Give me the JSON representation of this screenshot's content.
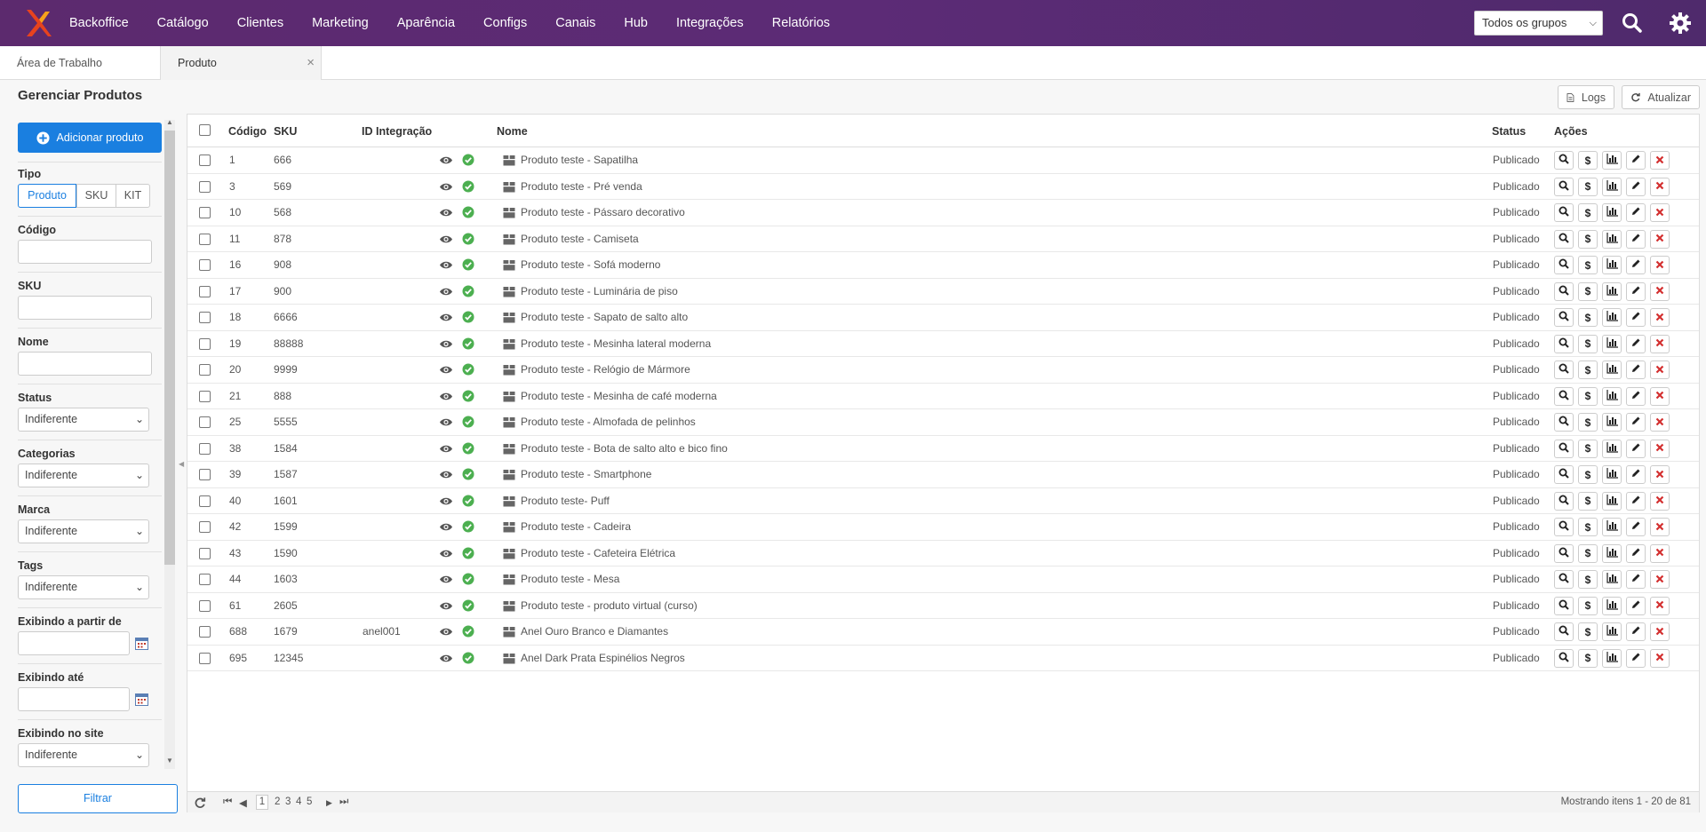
{
  "nav": {
    "items": [
      "Backoffice",
      "Catálogo",
      "Clientes",
      "Marketing",
      "Aparência",
      "Configs",
      "Canais",
      "Hub",
      "Integrações",
      "Relatórios"
    ],
    "group_select": "Todos os grupos"
  },
  "tabs": {
    "workspace": "Área de Trabalho",
    "product": "Produto"
  },
  "page": {
    "title": "Gerenciar Produtos",
    "logs": "Logs",
    "refresh": "Atualizar"
  },
  "sidebar": {
    "add_button": "Adicionar produto",
    "tipo_label": "Tipo",
    "tipo_options": [
      "Produto",
      "SKU",
      "KIT"
    ],
    "codigo_label": "Código",
    "sku_label": "SKU",
    "nome_label": "Nome",
    "status_label": "Status",
    "status_value": "Indiferente",
    "categorias_label": "Categorias",
    "categorias_value": "Indiferente",
    "marca_label": "Marca",
    "marca_value": "Indiferente",
    "tags_label": "Tags",
    "tags_value": "Indiferente",
    "from_label": "Exibindo a partir de",
    "until_label": "Exibindo até",
    "site_label": "Exibindo no site",
    "site_value": "Indiferente",
    "filter_button": "Filtrar"
  },
  "table": {
    "headers": {
      "codigo": "Código",
      "sku": "SKU",
      "id_integracao": "ID Integração",
      "nome": "Nome",
      "status": "Status",
      "acoes": "Ações"
    },
    "rows": [
      {
        "codigo": "1",
        "sku": "666",
        "id": "",
        "nome": "Produto teste - Sapatilha",
        "status": "Publicado"
      },
      {
        "codigo": "3",
        "sku": "569",
        "id": "",
        "nome": "Produto teste - Pré venda",
        "status": "Publicado"
      },
      {
        "codigo": "10",
        "sku": "568",
        "id": "",
        "nome": "Produto teste - Pássaro decorativo",
        "status": "Publicado"
      },
      {
        "codigo": "11",
        "sku": "878",
        "id": "",
        "nome": "Produto teste - Camiseta",
        "status": "Publicado"
      },
      {
        "codigo": "16",
        "sku": "908",
        "id": "",
        "nome": "Produto teste - Sofá moderno",
        "status": "Publicado"
      },
      {
        "codigo": "17",
        "sku": "900",
        "id": "",
        "nome": "Produto teste - Luminária de piso",
        "status": "Publicado"
      },
      {
        "codigo": "18",
        "sku": "6666",
        "id": "",
        "nome": "Produto teste - Sapato de salto alto",
        "status": "Publicado"
      },
      {
        "codigo": "19",
        "sku": "88888",
        "id": "",
        "nome": "Produto teste - Mesinha lateral moderna",
        "status": "Publicado"
      },
      {
        "codigo": "20",
        "sku": "9999",
        "id": "",
        "nome": "Produto teste - Relógio de Mármore",
        "status": "Publicado"
      },
      {
        "codigo": "21",
        "sku": "888",
        "id": "",
        "nome": "Produto teste - Mesinha de café moderna",
        "status": "Publicado"
      },
      {
        "codigo": "25",
        "sku": "5555",
        "id": "",
        "nome": "Produto teste - Almofada de pelinhos",
        "status": "Publicado"
      },
      {
        "codigo": "38",
        "sku": "1584",
        "id": "",
        "nome": "Produto teste - Bota de salto alto e bico fino",
        "status": "Publicado"
      },
      {
        "codigo": "39",
        "sku": "1587",
        "id": "",
        "nome": "Produto teste - Smartphone",
        "status": "Publicado"
      },
      {
        "codigo": "40",
        "sku": "1601",
        "id": "",
        "nome": "Produto teste- Puff",
        "status": "Publicado"
      },
      {
        "codigo": "42",
        "sku": "1599",
        "id": "",
        "nome": "Produto teste - Cadeira",
        "status": "Publicado"
      },
      {
        "codigo": "43",
        "sku": "1590",
        "id": "",
        "nome": "Produto teste - Cafeteira Elétrica",
        "status": "Publicado"
      },
      {
        "codigo": "44",
        "sku": "1603",
        "id": "",
        "nome": "Produto teste - Mesa",
        "status": "Publicado"
      },
      {
        "codigo": "61",
        "sku": "2605",
        "id": "",
        "nome": "Produto teste - produto virtual (curso)",
        "status": "Publicado"
      },
      {
        "codigo": "688",
        "sku": "1679",
        "id": "anel001",
        "nome": "Anel Ouro Branco e Diamantes",
        "status": "Publicado"
      },
      {
        "codigo": "695",
        "sku": "12345",
        "id": "",
        "nome": "Anel Dark Prata Espinélios Negros",
        "status": "Publicado"
      }
    ]
  },
  "pager": {
    "pages": [
      "1",
      "2",
      "3",
      "4",
      "5"
    ],
    "summary": "Mostrando itens 1 - 20 de 81"
  }
}
